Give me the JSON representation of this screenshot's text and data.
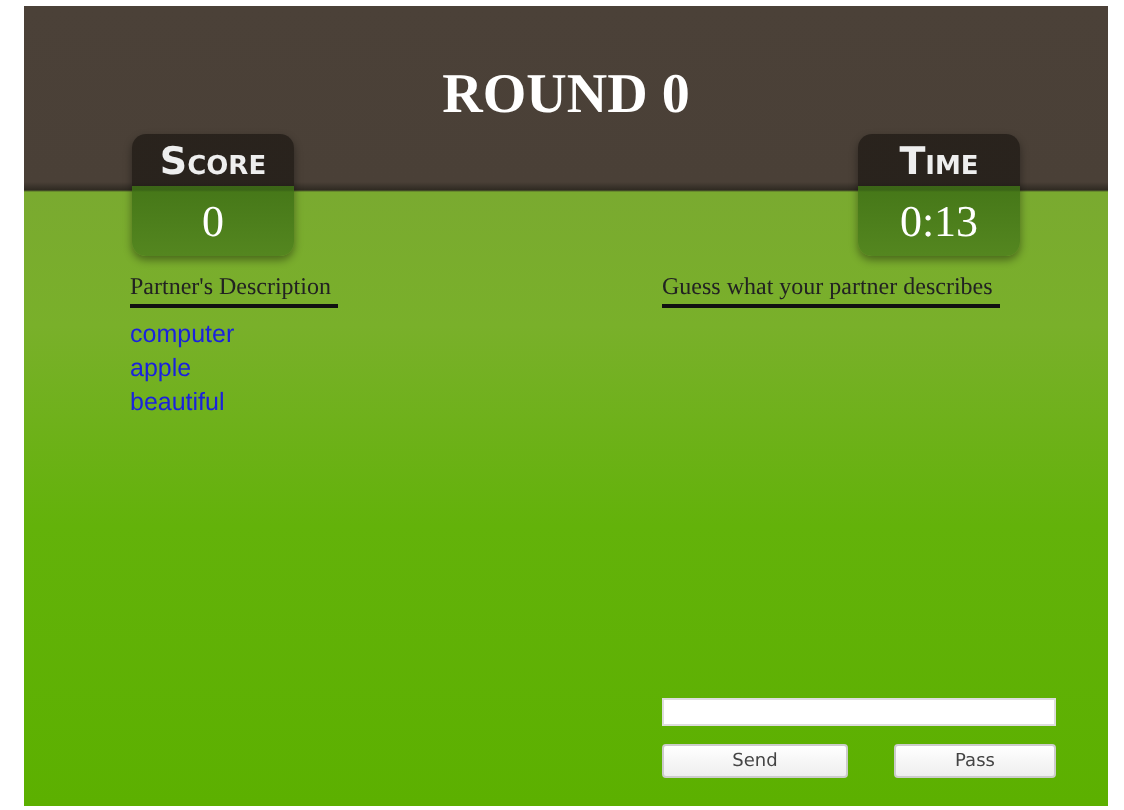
{
  "title": "ROUND 0",
  "stats": [
    {
      "label": "Score",
      "value": "0"
    },
    {
      "label": "Time",
      "value": "0:13"
    }
  ],
  "partner_heading": "Partner's Description",
  "guess_heading": "Guess what your partner describes",
  "words": [
    "computer",
    "apple",
    "beautiful"
  ],
  "buttons": [
    "Send",
    "Pass"
  ]
}
